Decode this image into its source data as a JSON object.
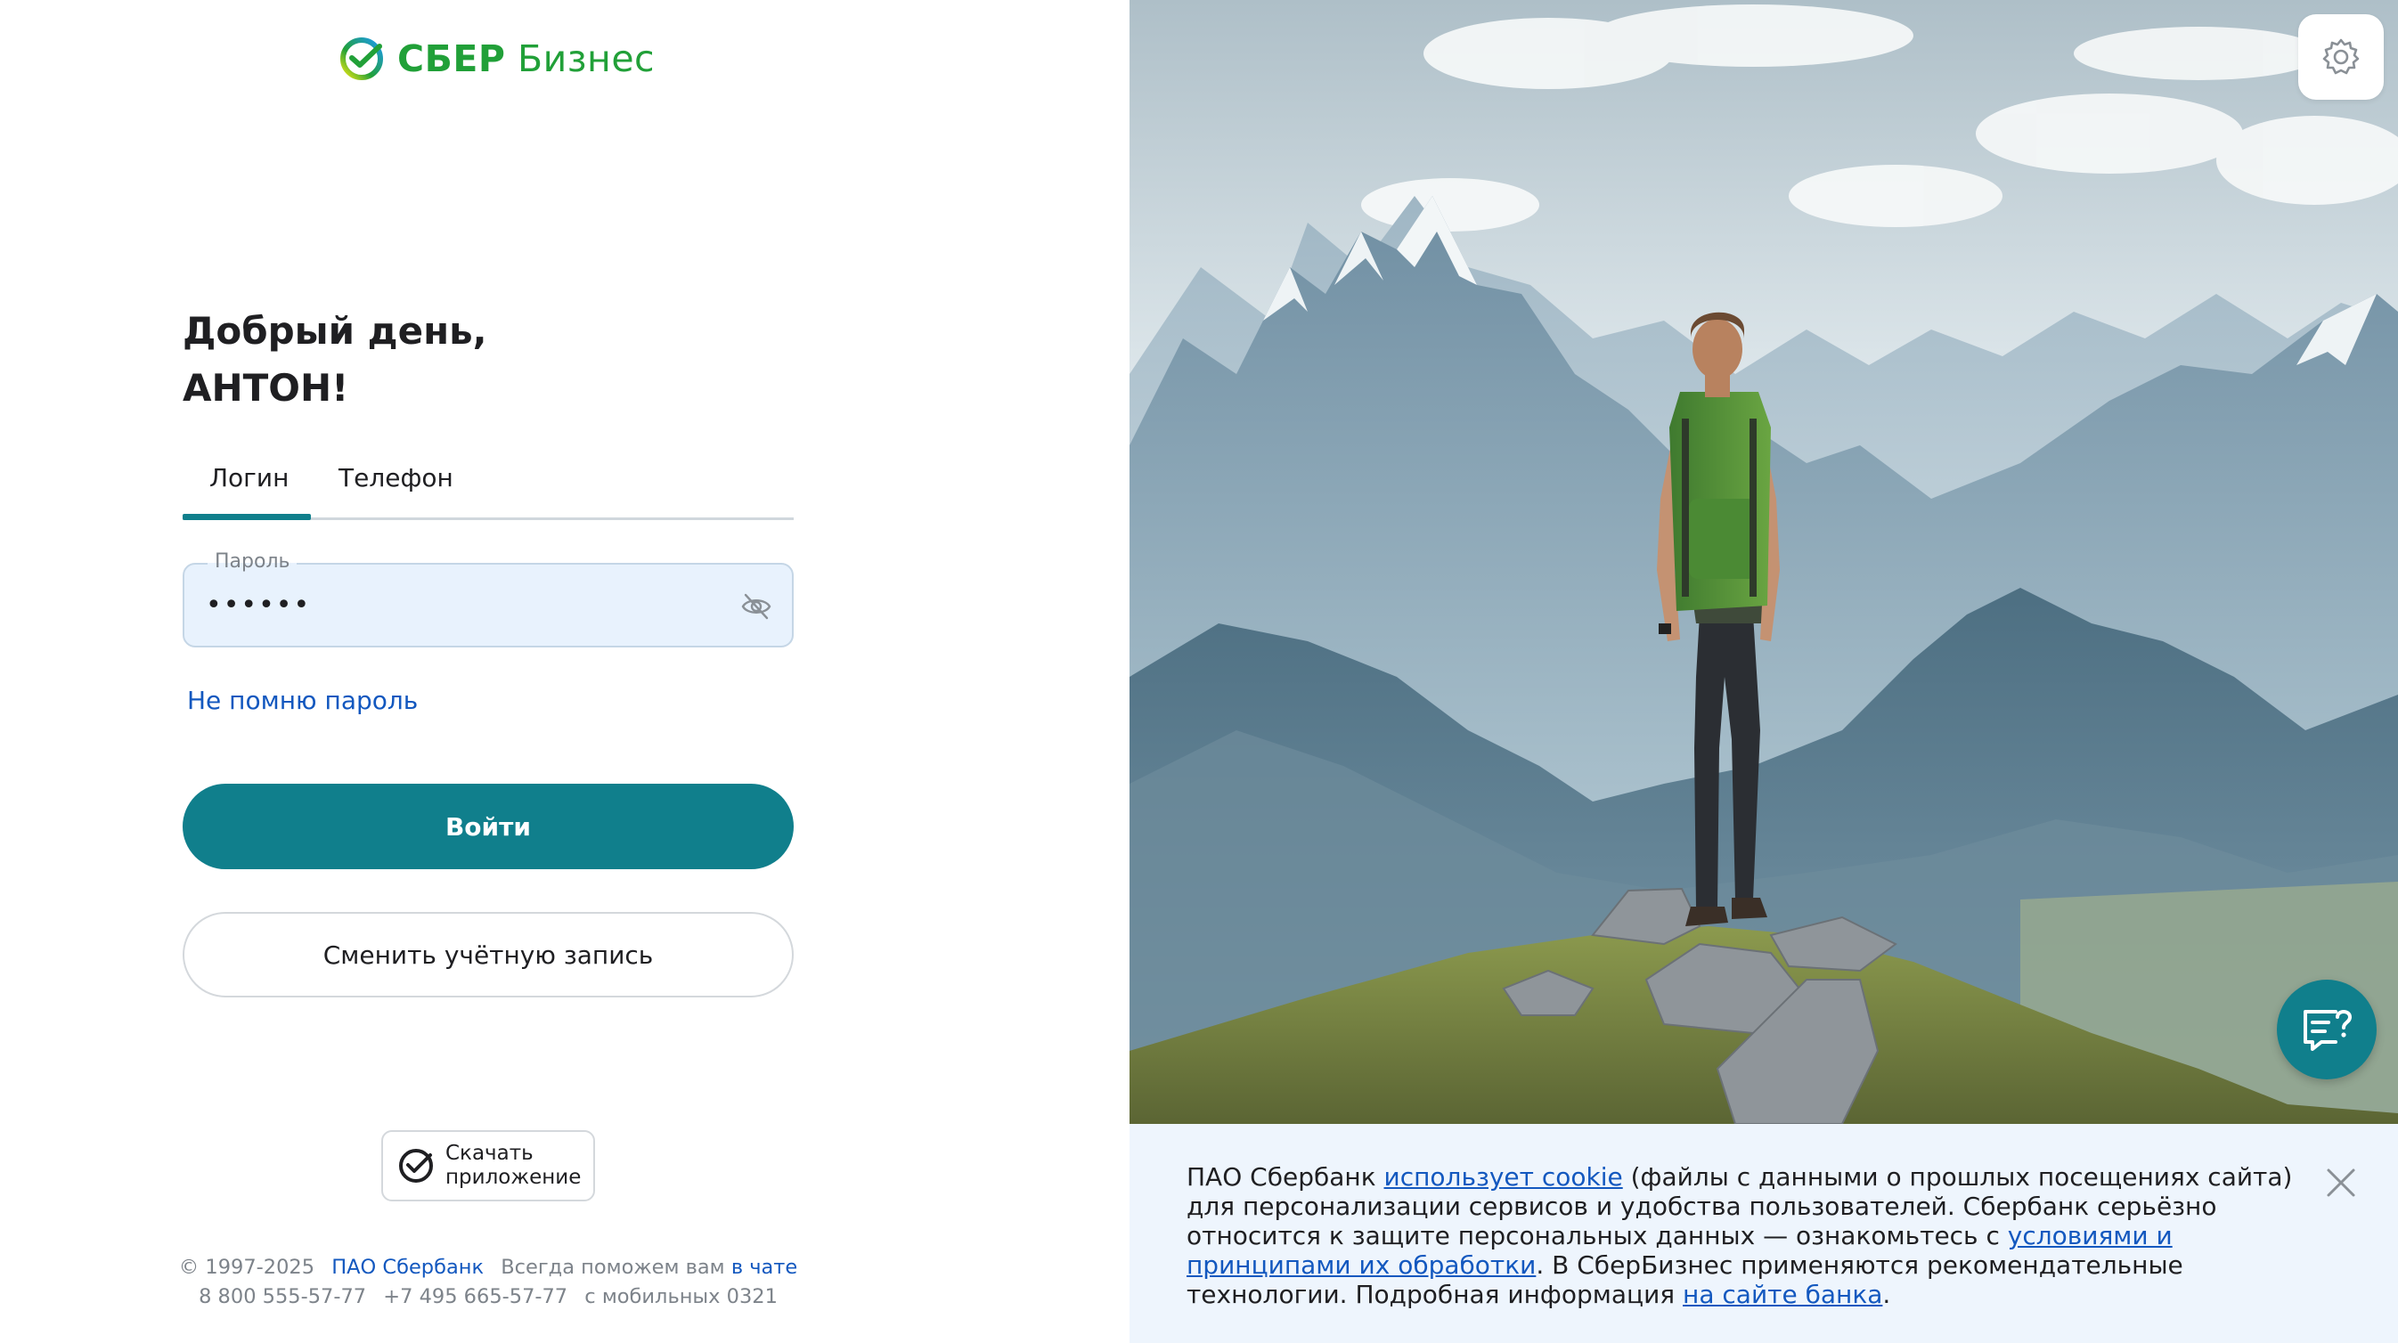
{
  "brand": {
    "name_bold": "СБЕР",
    "name_rest": "Бизнес",
    "color": "#21a038"
  },
  "greeting": {
    "line1": "Добрый день,",
    "line2": "АНТОН!"
  },
  "tabs": [
    {
      "label": "Логин",
      "active": true
    },
    {
      "label": "Телефон",
      "active": false
    }
  ],
  "password": {
    "label": "Пароль",
    "value": "••••••"
  },
  "forgot_label": "Не помню пароль",
  "login_button": "Войти",
  "switch_account_button": "Сменить учётную запись",
  "app_download": {
    "line1": "Скачать",
    "line2": "приложение"
  },
  "footer": {
    "copyright": "© 1997-2025",
    "bank_link": "ПАО Сбербанк",
    "help_prefix": "Всегда поможем вам",
    "chat_link": "в чате",
    "phone1": "8 800 555-57-77",
    "phone2": "+7 495 665-57-77",
    "mobile": "с мобильных 0321"
  },
  "cookie": {
    "t1": "ПАО Сбербанк ",
    "link1": "использует cookie",
    "t2": " (файлы с данными о прошлых посещениях сайта) для персонализации сервисов и удобства пользователей. Сбербанк серьёзно относится к защите персональных данных — ознакомьтесь с ",
    "link2": "условиями и принципами их обработки",
    "t3": ". В СберБизнес применяются рекомендательные технологии. Подробная информация ",
    "link3": "на сайте банка",
    "t4": "."
  },
  "colors": {
    "accent": "#107f8c",
    "link": "#1358bf",
    "field_bg": "#e8f2fd",
    "cookie_bg": "#eef5fd"
  },
  "icons": [
    "sber-logo-icon",
    "eye-off-icon",
    "sber-app-icon",
    "settings-gear-icon",
    "chat-help-icon",
    "close-icon"
  ]
}
